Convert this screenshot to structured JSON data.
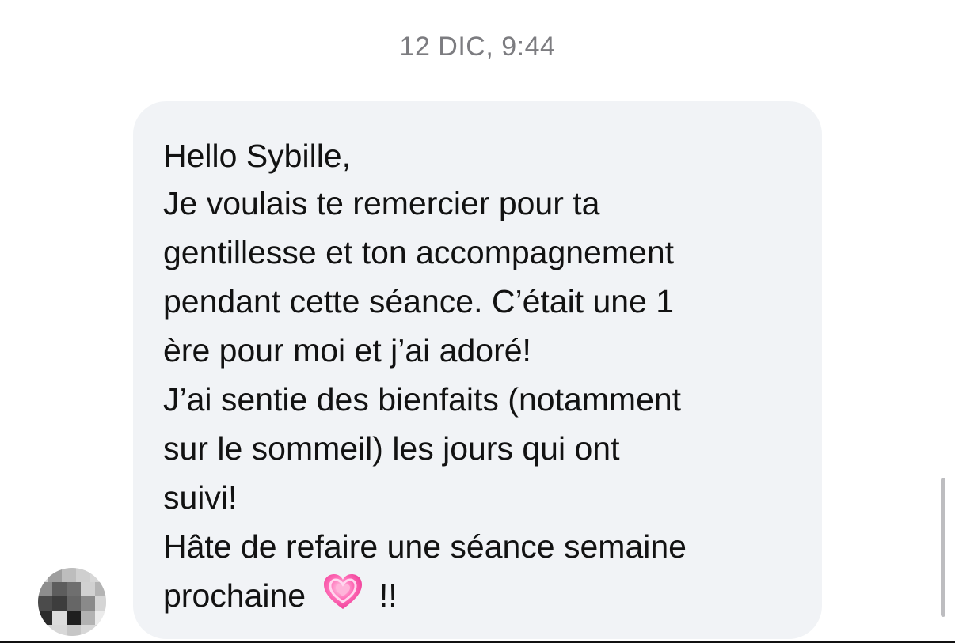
{
  "conversation": {
    "timestamp": "12 DIC, 9:44",
    "message_lines": [
      "Hello Sybille,",
      "Je voulais te remercier pour ta",
      "gentillesse et ton accompagnement",
      "pendant cette séance. C’était une 1",
      "ère pour moi et j’ai adoré!",
      "J’ai sentie des bienfaits (notamment",
      "sur le sommeil) les jours qui ont",
      "suivi!",
      "Hâte de refaire une séance semaine"
    ],
    "last_line": {
      "before_emoji": "prochaine",
      "emoji": "pink-heart",
      "after_emoji": "!!"
    }
  },
  "colors": {
    "bubble_background": "#f1f3f6",
    "text": "#121212",
    "timestamp": "#7c7c80",
    "heart": "#ff4fa3"
  },
  "icons": {
    "avatar": "pixelated-avatar",
    "heart": "sparkling-heart-icon"
  }
}
